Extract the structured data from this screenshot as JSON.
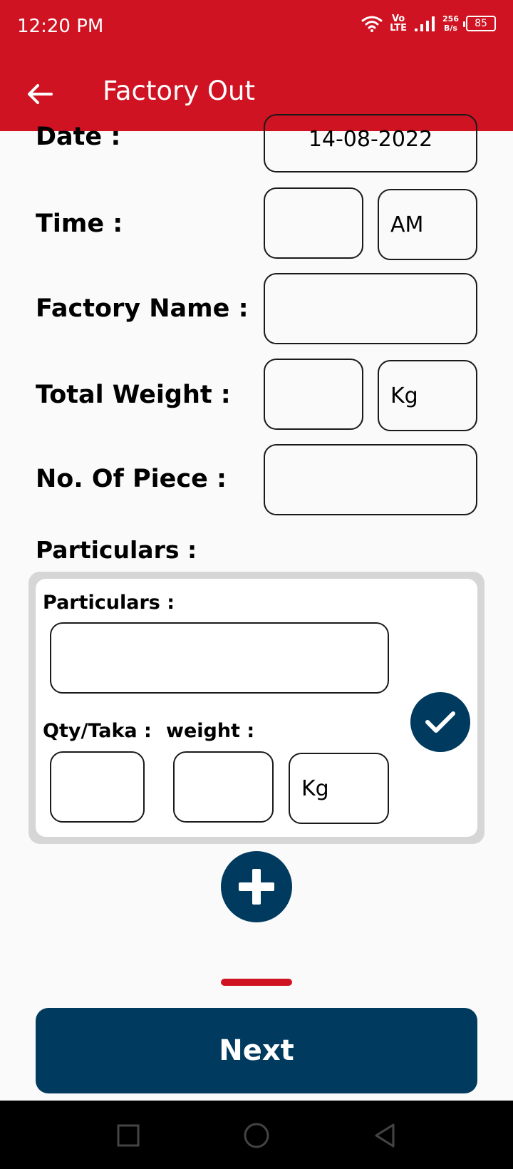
{
  "status_bar": {
    "time": "12:20 PM",
    "volte_top": "Vo",
    "volte_bottom": "LTE",
    "speed_value": "256",
    "speed_unit": "B/s",
    "battery": "85",
    "icons": [
      "wifi-icon",
      "volte-icon",
      "signal-icon",
      "battery-icon"
    ]
  },
  "app_bar": {
    "title": "Factory Out",
    "back_icon": "arrow-left-icon"
  },
  "form": {
    "date": {
      "label": "Date :",
      "value": "14-08-2022"
    },
    "time": {
      "label": "Time :",
      "value": "",
      "period": "AM"
    },
    "factory_name": {
      "label": "Factory Name :",
      "value": ""
    },
    "total_weight": {
      "label": "Total Weight :",
      "value": "",
      "unit": "Kg"
    },
    "pieces": {
      "label": "No. Of Piece :",
      "value": ""
    },
    "particulars_heading": "Particulars :"
  },
  "particulars_card": {
    "particulars_label": "Particulars :",
    "particulars_value": "",
    "qty_label": "Qty/Taka :",
    "qty_value": "",
    "weight_label": "weight :",
    "weight_value": "",
    "weight_unit": "Kg",
    "confirm_icon": "check-icon"
  },
  "actions": {
    "add_icon": "plus-icon",
    "next_label": "Next"
  },
  "colors": {
    "primary_red": "#cf1322",
    "primary_navy": "#003a5e",
    "background": "#fafafa"
  },
  "nav_bar": {
    "icons": [
      "recents-square-icon",
      "home-circle-icon",
      "back-triangle-icon"
    ]
  }
}
